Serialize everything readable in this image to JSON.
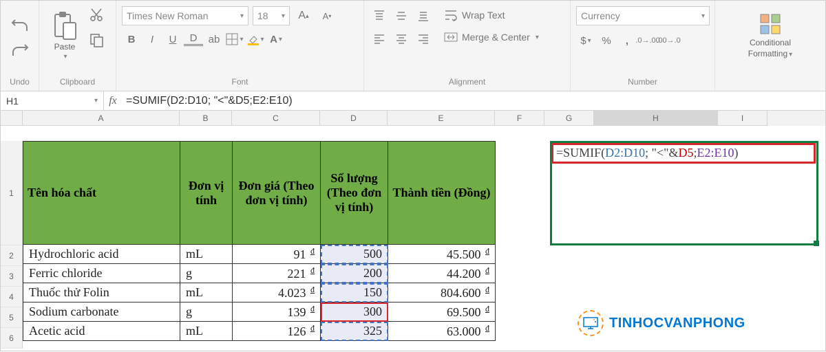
{
  "ribbon": {
    "undo": {
      "label": "Undo"
    },
    "clipboard": {
      "label": "Clipboard",
      "paste": "Paste"
    },
    "font": {
      "label": "Font",
      "name": "Times New Roman",
      "size": "18",
      "bold": "B",
      "italic": "I",
      "underline": "U",
      "double_u": "D"
    },
    "alignment": {
      "label": "Alignment",
      "wrap": "Wrap Text",
      "merge": "Merge & Center"
    },
    "number": {
      "label": "Number",
      "format": "Currency"
    },
    "conditional": {
      "line1": "Conditional",
      "line2": "Formatting"
    }
  },
  "name_box": "H1",
  "formula_bar": "=SUMIF(D2:D10; \"<\"&D5;E2:E10)",
  "columns": [
    "A",
    "B",
    "C",
    "D",
    "E",
    "F",
    "G",
    "H",
    "I"
  ],
  "headers": {
    "a": "Tên hóa chất",
    "b": "Đơn vị tính",
    "c": "Đơn giá (Theo đơn vị tính)",
    "d": "Số lượng (Theo đơn vị tính)",
    "e": "Thành tiền (Đồng)"
  },
  "rows": [
    {
      "n": "2",
      "a": "Hydrochloric acid",
      "b": "mL",
      "c": "91",
      "d": "500",
      "e": "45.500"
    },
    {
      "n": "3",
      "a": "Ferric chloride",
      "b": "g",
      "c": "221",
      "d": "200",
      "e": "44.200"
    },
    {
      "n": "4",
      "a": "Thuốc thử Folin",
      "b": "mL",
      "c": "4.023",
      "d": "150",
      "e": "804.600"
    },
    {
      "n": "5",
      "a": "Sodium carbonate",
      "b": "g",
      "c": "139",
      "d": "300",
      "e": "69.500"
    },
    {
      "n": "6",
      "a": "Acetic acid",
      "b": "mL",
      "c": "126",
      "d": "325",
      "e": "63.000"
    }
  ],
  "cell_formula": {
    "prefix": "=SUMIF(",
    "r1": "D2:D10",
    "mid1": "; \"<\"&",
    "r2": "D5",
    "mid2": ";",
    "r3": "E2:E10",
    "suffix": ")"
  },
  "watermark": "TINHOCVANPHONG"
}
